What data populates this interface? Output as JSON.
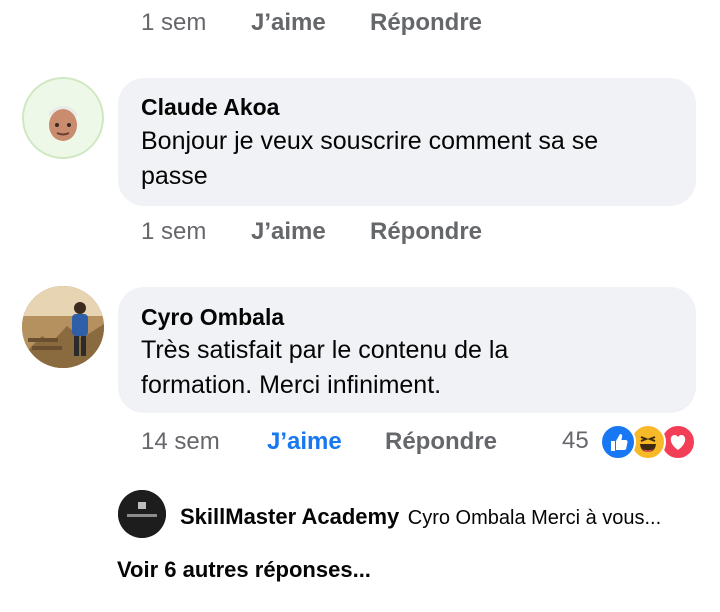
{
  "top_actions": {
    "time": "1 sem",
    "like": "J’aime",
    "reply": "Répondre"
  },
  "comments": [
    {
      "author": "Claude Akoa",
      "text": "Bonjour je veux souscrire comment sa se passe",
      "time": "1 sem",
      "like": "J’aime",
      "reply": "Répondre"
    },
    {
      "author": "Cyro Ombala",
      "text": "Très satisfait par le contenu de la formation. Merci infiniment.",
      "time": "14 sem",
      "like": "J’aime",
      "reply": "Répondre",
      "reaction_count": "45",
      "reactions": [
        "like-icon",
        "haha-icon",
        "love-icon"
      ]
    }
  ],
  "reply_preview": {
    "author": "SkillMaster Academy",
    "text": "Cyro Ombala Merci à vous..."
  },
  "more_replies": "Voir 6 autres réponses...",
  "colors": {
    "bubble": "#f0f2f5",
    "meta": "#65676b",
    "liked": "#1877f2",
    "like_reaction": "#1877f2",
    "haha_reaction": "#f7b928",
    "love_reaction": "#f33e58"
  }
}
